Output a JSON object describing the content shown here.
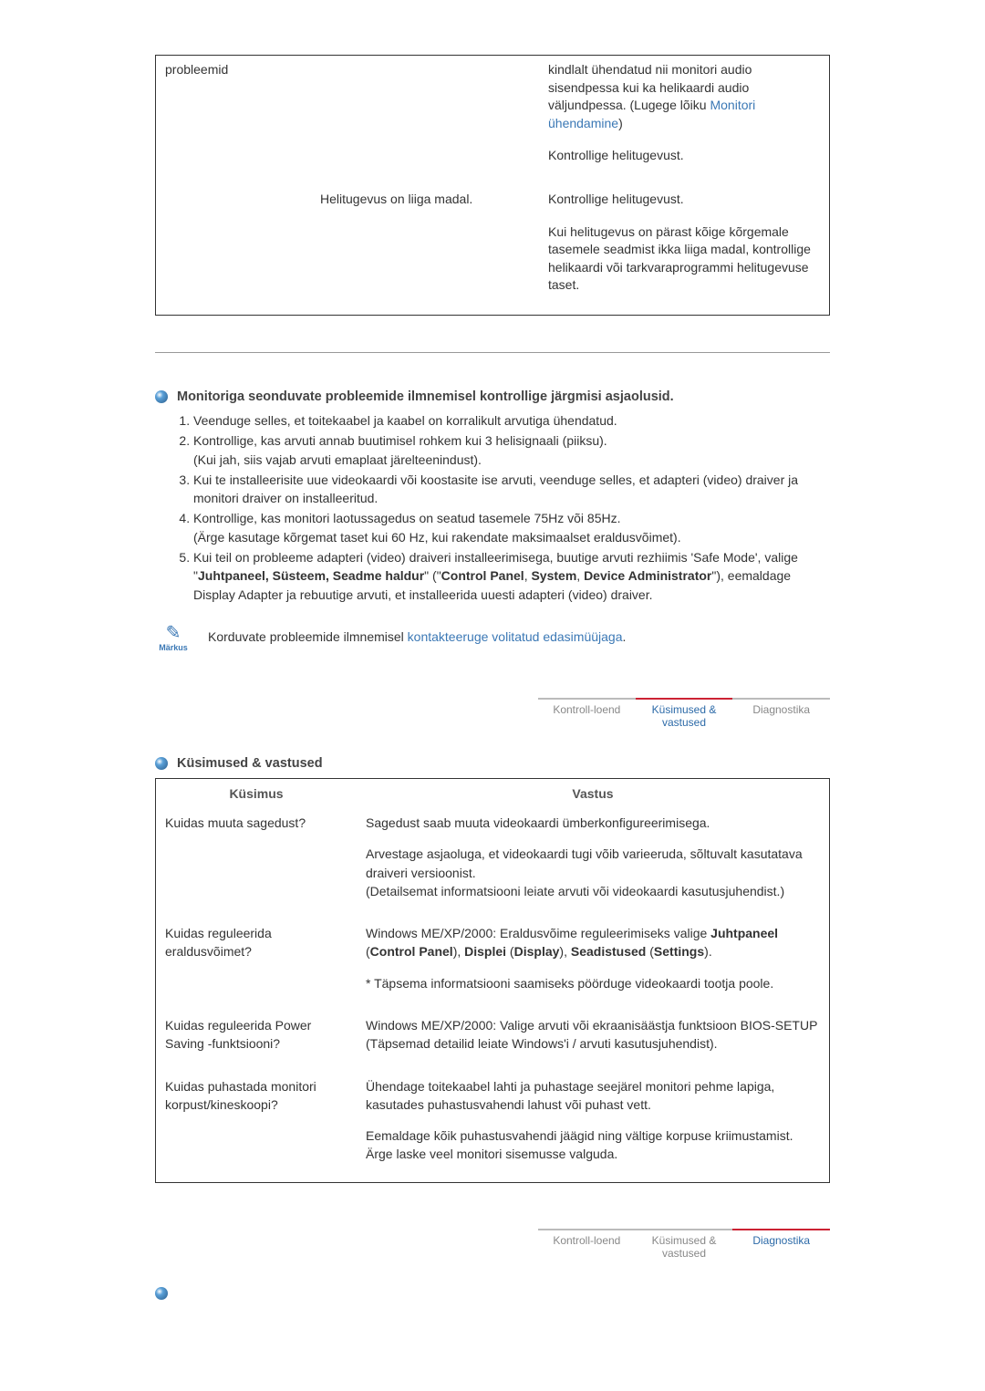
{
  "trouble_table": {
    "rows": [
      {
        "c1": "probleemid",
        "c2": "",
        "answers": [
          {
            "pre": "kindlalt ühendatud nii monitori audio sisendpessa kui ka helikaardi audio väljundpessa.\n(Lugege lõiku ",
            "link": "Monitori ühendamine",
            "post": ")"
          },
          {
            "pre": "Kontrollige helitugevust."
          }
        ]
      },
      {
        "c1": "",
        "c2": "Helitugevus on liiga madal.",
        "answers": [
          {
            "pre": "Kontrollige helitugevust."
          },
          {
            "pre": "Kui helitugevus on pärast kõige kõrgemale tasemele seadmist ikka liiga madal, kontrollige helikaardi või tarkvaraprogrammi helitugevuse taset."
          }
        ]
      }
    ]
  },
  "section1": {
    "title": "Monitoriga seonduvate probleemide ilmnemisel kontrollige järgmisi asjaolusid.",
    "items": [
      "Veenduge selles, et toitekaabel ja kaabel on korralikult arvutiga ühendatud.",
      "Kontrollige, kas arvuti annab buutimisel rohkem kui 3 helisignaali (piiksu).\n(Kui jah, siis vajab arvuti emaplaat järelteenindust).",
      "Kui te installeerisite uue videokaardi või koostasite ise arvuti, veenduge selles, et adapteri (video) draiver ja monitori draiver on installeeritud.",
      "Kontrollige, kas monitori laotussagedus on seatud tasemele 75Hz või 85Hz.\n(Ärge kasutage kõrgemat taset kui 60 Hz, kui rakendate maksimaalset eraldusvõimet).",
      "Kui teil on probleeme adapteri (video) draiveri installeerimisega, buutige arvuti rezhiimis 'Safe Mode', valige \"Juhtpaneel, Süsteem, Seadme haldur\" (\"Control Panel, System, Device Administrator\"), eemaldage Display Adapter ja rebuutige arvuti, et installeerida uuesti adapteri (video) draiver."
    ],
    "item5_bold1": "Juhtpaneel, Süsteem, Seadme haldur",
    "item5_bold2": "Control Panel",
    "item5_bold3": "System",
    "item5_bold4": "Device Administrator"
  },
  "note": {
    "label": "Märkus",
    "pre": "Korduvate probleemide ilmnemisel ",
    "link": "kontakteeruge volitatud edasimüüjaga",
    "post": "."
  },
  "tabs": {
    "items": [
      "Kontroll-loend",
      "Küsimused & vastused",
      "Diagnostika"
    ]
  },
  "qa": {
    "title": "Küsimused & vastused",
    "head_q": "Küsimus",
    "head_a": "Vastus",
    "rows": [
      {
        "q": "Kuidas muuta sagedust?",
        "answers": [
          "Sagedust saab muuta videokaardi ümberkonfigureerimisega.",
          "Arvestage asjaoluga, et videokaardi tugi võib varieeruda, sõltuvalt kasutatava draiveri versioonist.\n(Detailsemat informatsiooni leiate arvuti või videokaardi kasutusjuhendist.)"
        ]
      },
      {
        "q": "Kuidas reguleerida eraldusvõimet?",
        "answers_rich": [
          {
            "parts": [
              {
                "t": "Windows ME/XP/2000: Eraldusvõime reguleerimiseks valige "
              },
              {
                "t": "Juhtpaneel",
                "b": true
              },
              {
                "t": " ("
              },
              {
                "t": "Control Panel",
                "b": true
              },
              {
                "t": "), "
              },
              {
                "t": "Displei",
                "b": true
              },
              {
                "t": " ("
              },
              {
                "t": "Display",
                "b": true
              },
              {
                "t": "), "
              },
              {
                "t": "Seadistused",
                "b": true
              },
              {
                "t": " ("
              },
              {
                "t": "Settings",
                "b": true
              },
              {
                "t": ")."
              }
            ]
          },
          {
            "parts": [
              {
                "t": "* Täpsema informatsiooni saamiseks pöörduge videokaardi tootja poole."
              }
            ]
          }
        ]
      },
      {
        "q": "Kuidas reguleerida Power Saving -funktsiooni?",
        "answers": [
          "Windows ME/XP/2000: Valige arvuti või ekraanisäästja funktsioon BIOS-SETUP (Täpsemad detailid leiate Windows'i / arvuti kasutusjuhendist)."
        ]
      },
      {
        "q": "Kuidas puhastada monitori korpust/kineskoopi?",
        "answers": [
          "Ühendage toitekaabel lahti ja puhastage seejärel monitori pehme lapiga, kasutades puhastusvahendi lahust või puhast vett.",
          "Eemaldage kõik puhastusvahendi jäägid ning vältige korpuse kriimustamist. Ärge laske veel monitori sisemusse valguda."
        ]
      }
    ]
  }
}
